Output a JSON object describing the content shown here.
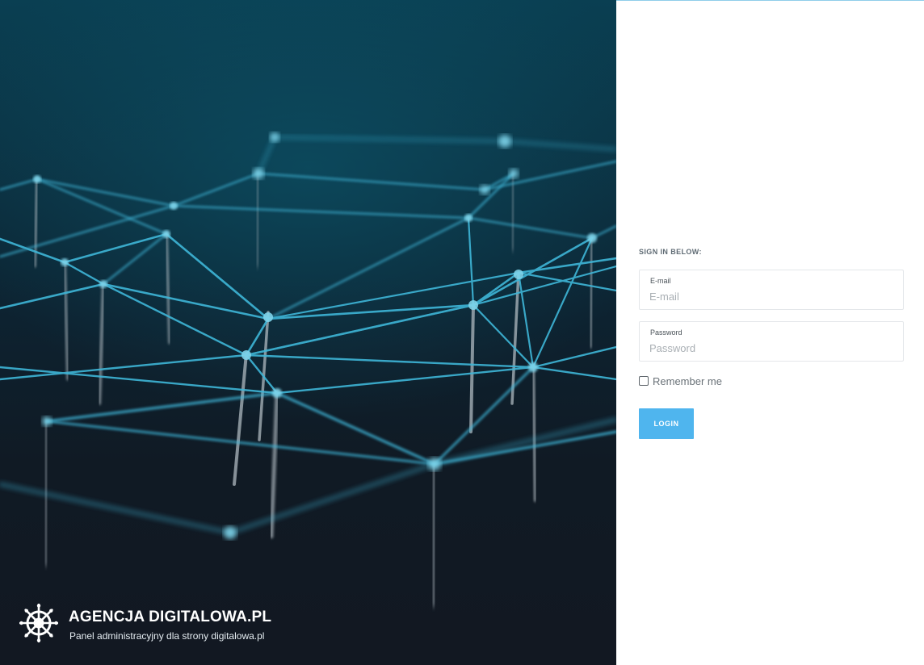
{
  "brand": {
    "title": "AGENCJA DIGITALOWA.PL",
    "subtitle": "Panel administracyjny dla strony digitalowa.pl",
    "logo_icon": "ship-wheel-icon"
  },
  "hero": {
    "image_description_icon": "network-pins-image"
  },
  "login": {
    "heading": "SIGN IN BELOW:",
    "email_label": "E-mail",
    "email_placeholder": "E-mail",
    "email_value": "",
    "password_label": "Password",
    "password_placeholder": "Password",
    "password_value": "",
    "remember_label": "Remember me",
    "remember_checked": false,
    "button_label": "LOGIN"
  },
  "colors": {
    "accent": "#4fb5ee",
    "hero_dark": "#121822",
    "hero_teal": "#0a3f52",
    "thread": "#3fb6d8"
  }
}
